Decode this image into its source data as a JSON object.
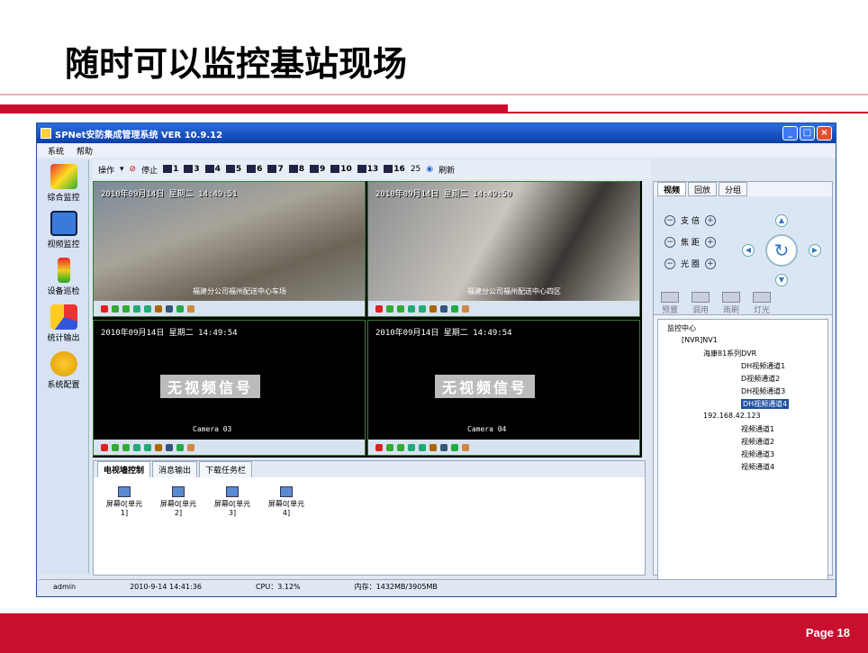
{
  "slide": {
    "title": "随时可以监控基站现场",
    "page": "Page 18",
    "colors": {
      "accent": "#c8102e"
    }
  },
  "window": {
    "title": "SPNet安防集成管理系统 VER 10.9.12",
    "controls": [
      "_",
      "□",
      "×"
    ],
    "menu": [
      "系统",
      "帮助"
    ],
    "nav": [
      "综合监控",
      "视频监控",
      "设备巡检",
      "统计输出",
      "系统配置"
    ],
    "toolbar": {
      "operate": "操作",
      "stop": "停止",
      "layouts": [
        "1",
        "3",
        "4",
        "5",
        "6",
        "7",
        "8",
        "9",
        "10",
        "13",
        "16",
        "25"
      ],
      "refresh": "刷新"
    },
    "cells": [
      {
        "timestamp": "2010年09月14日 星期二 14:49:51",
        "overlay": "福建分公司福州配送中心车场",
        "camera": "",
        "signal": ""
      },
      {
        "timestamp": "2010年09月14日 星期二 14:49:50",
        "overlay": "福建分公司福州配送中心四区",
        "camera": "",
        "signal": ""
      },
      {
        "timestamp": "2010年09月14日 星期二 14:49:54",
        "overlay": "",
        "camera": "Camera 03",
        "signal": "无视频信号"
      },
      {
        "timestamp": "2010年09月14日 星期二 14:49:54",
        "overlay": "",
        "camera": "Camera 04",
        "signal": "无视频信号"
      }
    ],
    "bottom": {
      "tabs": [
        "电视墙控制",
        "消息输出",
        "下载任务栏"
      ],
      "screens": [
        {
          "name": "屏幕0[单元",
          "num": "1]"
        },
        {
          "name": "屏幕0[单元",
          "num": "2]"
        },
        {
          "name": "屏幕0[单元",
          "num": "3]"
        },
        {
          "name": "屏幕0[单元",
          "num": "4]"
        }
      ]
    },
    "right": {
      "tabs": [
        "视频",
        "回放",
        "分组"
      ],
      "ptz": {
        "rows": [
          "支 倍",
          "焦 距",
          "光 圈"
        ],
        "presets": [
          "预置",
          "调用",
          "雨刷",
          "灯光"
        ]
      },
      "tree": {
        "root": "监控中心",
        "nvr": "[NVR]NV1",
        "dvr1": "海康81系列DVR",
        "ch1": [
          "DH视频通道1",
          "D视频通道2",
          "DH视频通道3",
          "DH视频通道4"
        ],
        "dvr2": "192.168.42.123",
        "ch2": [
          "视频通道1",
          "视频通道2",
          "视频通道3",
          "视频通道4"
        ]
      }
    },
    "status": {
      "user": "admin",
      "datetime": "2010-9-14 14:41:36",
      "cpu": "CPU：3.12%",
      "memory": "内存：1432MB/3905MB"
    }
  }
}
